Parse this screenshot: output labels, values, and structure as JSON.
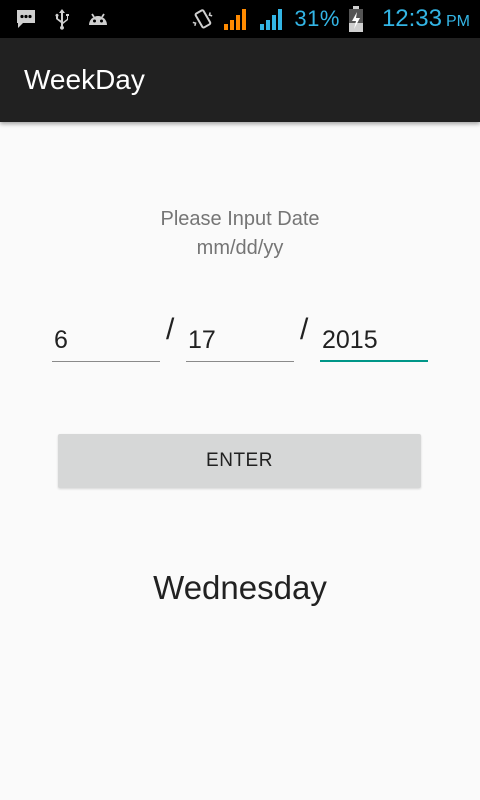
{
  "status_bar": {
    "battery_percent": "31%",
    "time": "12:33",
    "ampm": "PM",
    "icons": [
      "message-icon",
      "usb-icon",
      "android-icon",
      "vibrate-icon",
      "signal-icon",
      "signal-icon",
      "battery-charging-icon"
    ],
    "accent_color": "#33b5e5"
  },
  "app_bar": {
    "title": "WeekDay"
  },
  "prompt": {
    "line1": "Please Input Date",
    "line2": "mm/dd/yy"
  },
  "date_inputs": {
    "month": "6",
    "day": "17",
    "year": "2015",
    "separator": "/"
  },
  "enter_button": {
    "label": "ENTER"
  },
  "result": {
    "weekday": "Wednesday"
  },
  "colors": {
    "focus_underline": "#009688",
    "app_bar_bg": "#212121",
    "button_bg": "#d6d7d7"
  }
}
